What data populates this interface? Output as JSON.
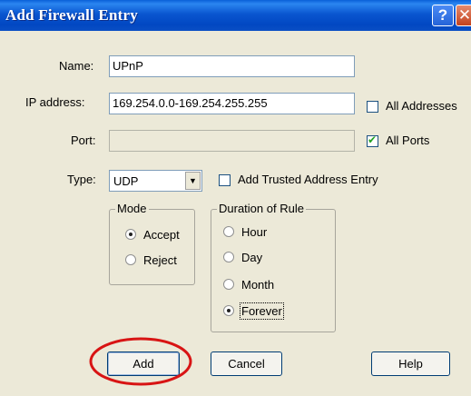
{
  "window": {
    "title": "Add Firewall Entry",
    "help_glyph": "?",
    "close_glyph": "✕"
  },
  "form": {
    "name_label": "Name:",
    "name_value": "UPnP",
    "ip_label": "IP address:",
    "ip_value": "169.254.0.0-169.254.255.255",
    "all_addresses_label": "All Addresses",
    "all_addresses_checked": false,
    "port_label": "Port:",
    "port_value": "",
    "all_ports_label": "All Ports",
    "all_ports_checked": true,
    "type_label": "Type:",
    "type_value": "UDP",
    "trusted_label": "Add Trusted Address Entry",
    "trusted_checked": false
  },
  "mode": {
    "legend": "Mode",
    "options": [
      {
        "label": "Accept",
        "selected": true
      },
      {
        "label": "Reject",
        "selected": false
      }
    ]
  },
  "duration": {
    "legend": "Duration of Rule",
    "options": [
      {
        "label": "Hour",
        "selected": false
      },
      {
        "label": "Day",
        "selected": false
      },
      {
        "label": "Month",
        "selected": false
      },
      {
        "label": "Forever",
        "selected": true
      }
    ]
  },
  "buttons": {
    "add": "Add",
    "cancel": "Cancel",
    "help": "Help"
  },
  "check_glyph": "✔",
  "dropdown_glyph": "▼",
  "colors": {
    "titlebar": "#0147c2",
    "dialog_bg": "#ece9d8",
    "highlight_ring": "#d81414"
  }
}
